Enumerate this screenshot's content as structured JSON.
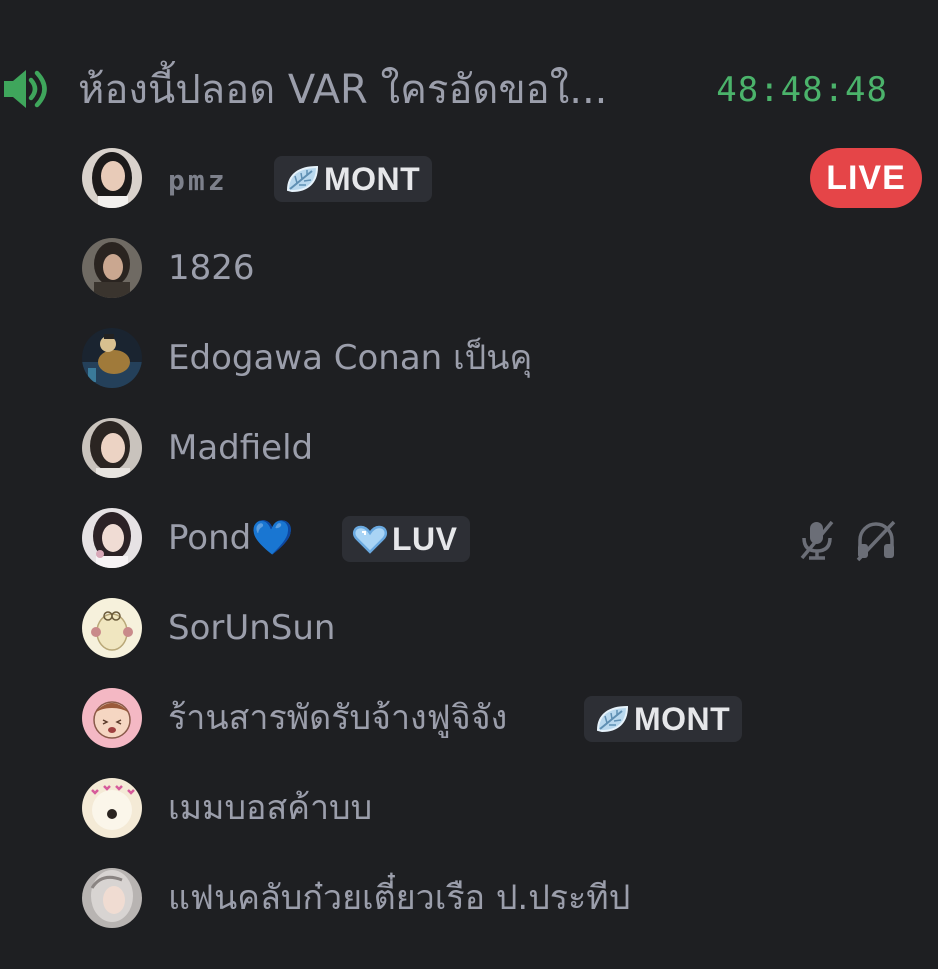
{
  "channel": {
    "name": "ห้องนี้ปลอด VAR ใครอัดขอใ...",
    "timer": "48:48:48",
    "icon": "speaker-icon"
  },
  "members": [
    {
      "name": "pmz",
      "avatar": "avatar-pmz",
      "tag": {
        "label": "MONT",
        "icon": "leaf-icon"
      },
      "badge": "LIVE"
    },
    {
      "name": "1826",
      "avatar": "avatar-1826"
    },
    {
      "name": "Edogawa Conan เป็นคุ",
      "avatar": "avatar-conan"
    },
    {
      "name": "Madfield",
      "avatar": "avatar-madfield"
    },
    {
      "name": "Pond💙",
      "avatar": "avatar-pond",
      "tag": {
        "label": "LUV",
        "icon": "heart-icon"
      },
      "status_icons": [
        "muted-mic-icon",
        "deafened-headphones-icon"
      ]
    },
    {
      "name": "SorUnSun",
      "avatar": "avatar-sorunsun"
    },
    {
      "name": "ร้านสารพัดรับจ้างฟูจิจัง",
      "avatar": "avatar-fuji",
      "tag": {
        "label": "MONT",
        "icon": "leaf-icon"
      }
    },
    {
      "name": "เมมบอสค้าบบ",
      "avatar": "avatar-mem"
    },
    {
      "name": "แฟนคลับก๋วยเตี๋ยวเรือ ป.ประทีป",
      "avatar": "avatar-fanclub"
    }
  ],
  "colors": {
    "background": "#1e1f22",
    "text": "#9b9eab",
    "timer": "#4bb36b",
    "live": "#e54548",
    "tag_bg": "#2d2f35"
  }
}
